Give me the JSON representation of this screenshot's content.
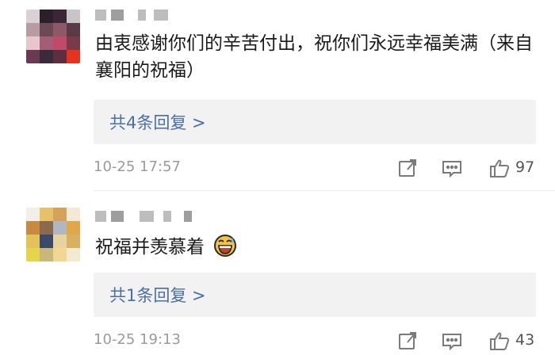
{
  "comments": [
    {
      "text": "由衷感谢你们的辛苦付出，祝你们永远幸福美满（来自襄阳的祝福）",
      "replies_label": "共4条回复 >",
      "time": "10-25 17:57",
      "likes": "97",
      "icons": [
        "share-icon",
        "comment-icon",
        "like-icon"
      ]
    },
    {
      "text": "祝福并羡慕着",
      "emoji": "grinning-sweat-emoji",
      "replies_label": "共1条回复 >",
      "time": "10-25 19:13",
      "likes": "43",
      "icons": [
        "share-icon",
        "comment-icon",
        "like-icon"
      ]
    }
  ],
  "colors": {
    "reply_link": "#4a6fa5",
    "meta_gray": "#9a9a9a",
    "reply_bg": "#f2f2f2"
  }
}
